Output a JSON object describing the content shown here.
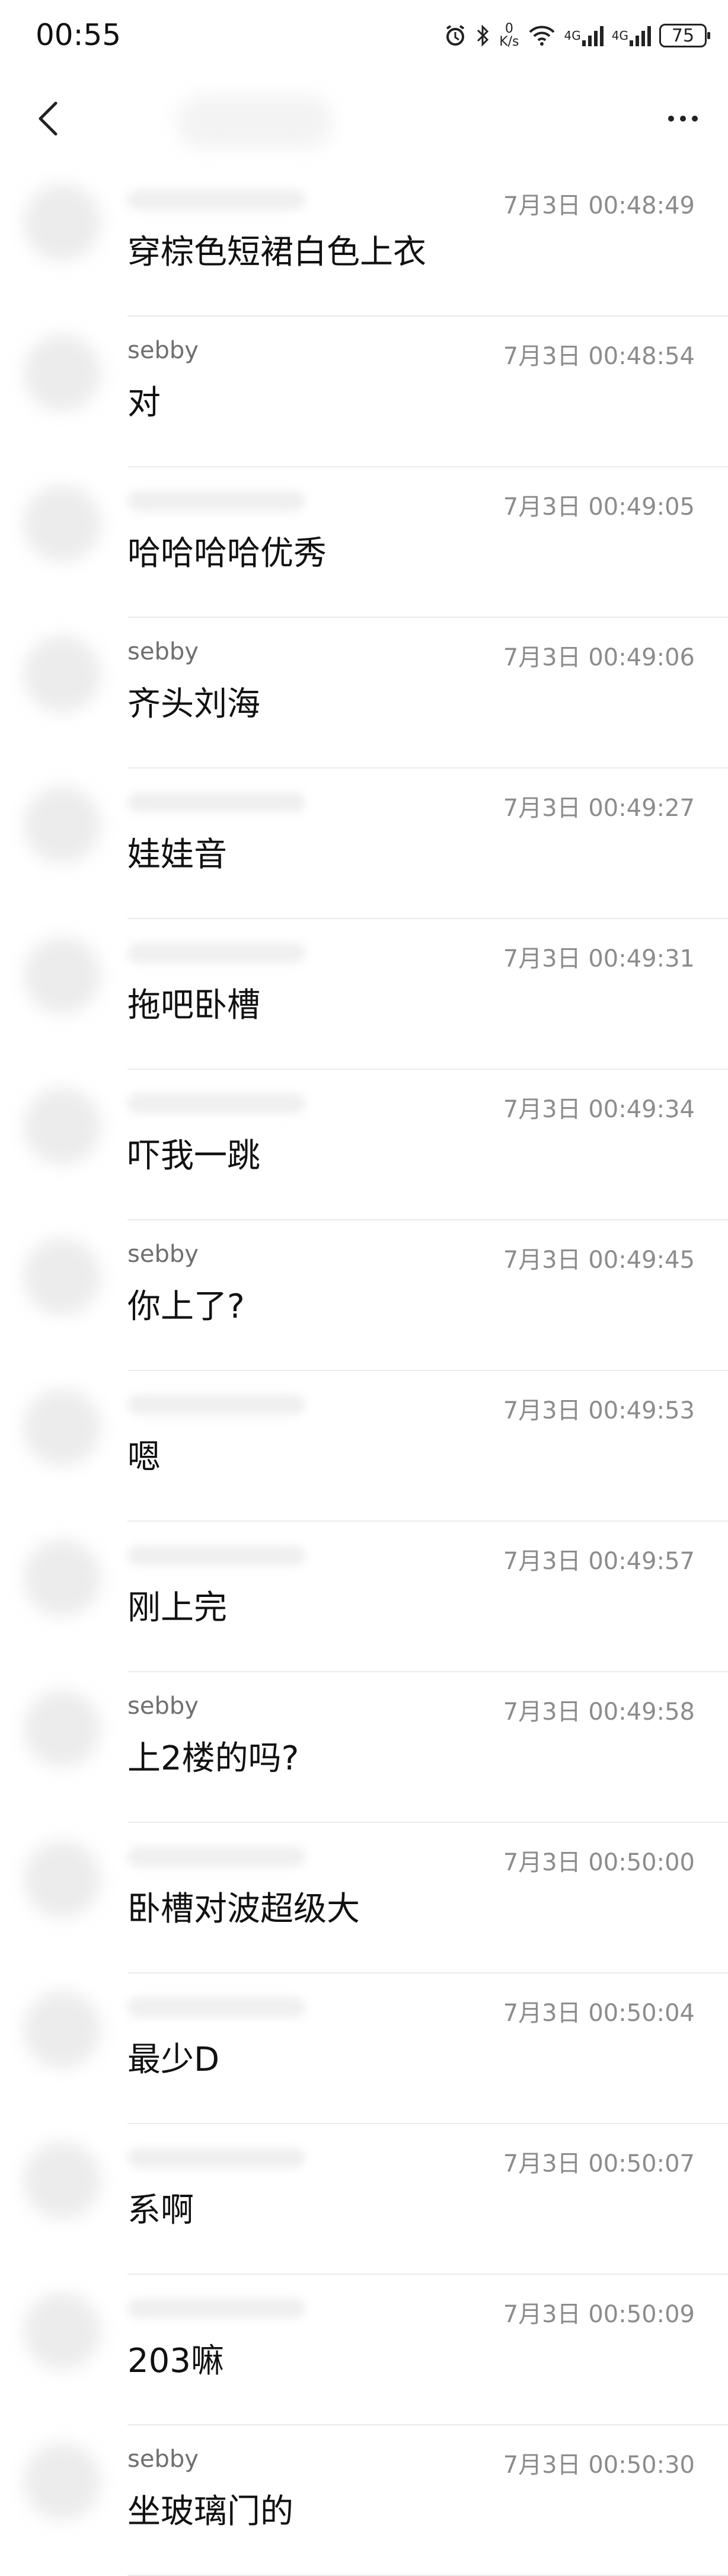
{
  "status_bar": {
    "time": "00:55",
    "net_speed_value": "0",
    "net_speed_unit": "K/s",
    "signal1_label": "4G",
    "signal2_label": "4G",
    "battery": "75"
  },
  "messages": [
    {
      "sender": "",
      "time": "7月3日 00:48:49",
      "text": "穿棕色短裙白色上衣"
    },
    {
      "sender": "sebby",
      "time": "7月3日 00:48:54",
      "text": "对"
    },
    {
      "sender": "",
      "time": "7月3日 00:49:05",
      "text": "哈哈哈哈优秀"
    },
    {
      "sender": "sebby",
      "time": "7月3日 00:49:06",
      "text": "齐头刘海"
    },
    {
      "sender": "",
      "time": "7月3日 00:49:27",
      "text": "娃娃音"
    },
    {
      "sender": "",
      "time": "7月3日 00:49:31",
      "text": "拖吧卧槽"
    },
    {
      "sender": "",
      "time": "7月3日 00:49:34",
      "text": "吓我一跳"
    },
    {
      "sender": "sebby",
      "time": "7月3日 00:49:45",
      "text": "你上了?"
    },
    {
      "sender": "",
      "time": "7月3日 00:49:53",
      "text": "嗯"
    },
    {
      "sender": "",
      "time": "7月3日 00:49:57",
      "text": "刚上完"
    },
    {
      "sender": "sebby",
      "time": "7月3日 00:49:58",
      "text": "上2楼的吗?"
    },
    {
      "sender": "",
      "time": "7月3日 00:50:00",
      "text": "卧槽对波超级大"
    },
    {
      "sender": "",
      "time": "7月3日 00:50:04",
      "text": "最少D"
    },
    {
      "sender": "",
      "time": "7月3日 00:50:07",
      "text": "系啊"
    },
    {
      "sender": "",
      "time": "7月3日 00:50:09",
      "text": "203嘛"
    },
    {
      "sender": "sebby",
      "time": "7月3日 00:50:30",
      "text": "坐玻璃门的"
    }
  ]
}
